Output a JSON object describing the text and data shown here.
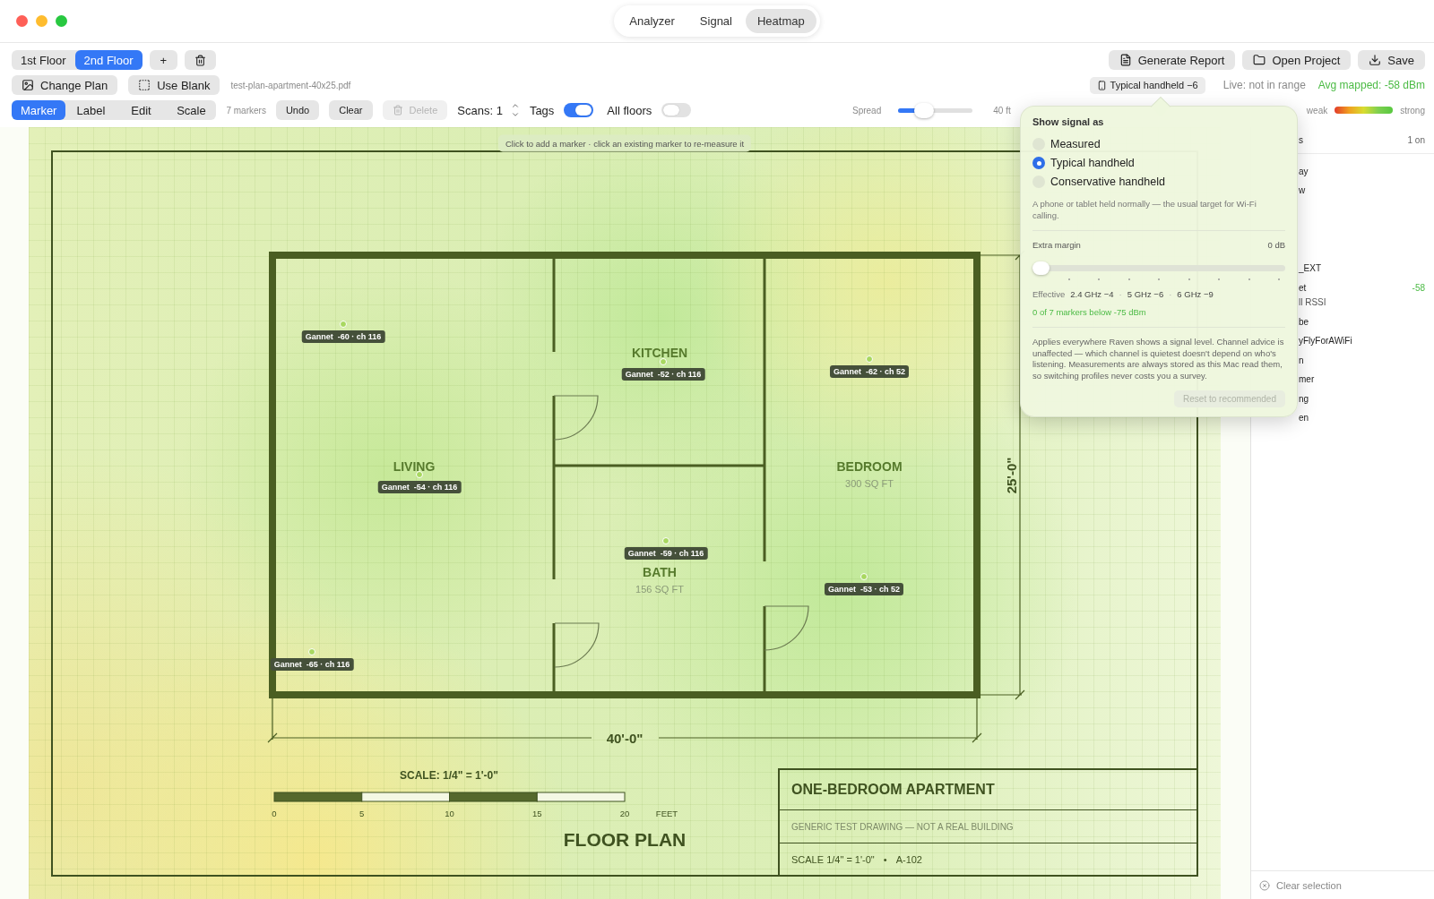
{
  "window": {
    "tabs": [
      {
        "label": "Analyzer",
        "selected": false
      },
      {
        "label": "Signal",
        "selected": false
      },
      {
        "label": "Heatmap",
        "selected": true
      }
    ]
  },
  "floors": {
    "tabs": [
      {
        "label": "1st Floor",
        "selected": false
      },
      {
        "label": "2nd Floor",
        "selected": true
      }
    ],
    "add": "+"
  },
  "plan_buttons": [
    {
      "label": "Change Plan",
      "kind": "image"
    },
    {
      "label": "Use Blank",
      "kind": "blank"
    }
  ],
  "file_name": "test-plan-apartment-40x25.pdf",
  "modes": [
    {
      "label": "Marker",
      "selected": true
    },
    {
      "label": "Label",
      "selected": false
    },
    {
      "label": "Edit",
      "selected": false
    },
    {
      "label": "Scale",
      "selected": false
    }
  ],
  "marker_count": "7 markers",
  "actions": [
    {
      "label": "Undo",
      "disabled": false,
      "kind": "text"
    },
    {
      "label": "Clear",
      "disabled": false,
      "kind": "text"
    },
    {
      "label": "Delete",
      "disabled": true,
      "kind": "trash"
    }
  ],
  "scans": "Scans: 1",
  "toggles": [
    {
      "label": "Tags",
      "on": true
    },
    {
      "label": "All floors",
      "on": false
    }
  ],
  "top_actions": [
    {
      "label": "Generate Report",
      "kind": "report"
    },
    {
      "label": "Open Project",
      "kind": "folder"
    },
    {
      "label": "Save",
      "kind": "save"
    }
  ],
  "profile_button": "Typical handheld −6",
  "live_status": "Live: not in range",
  "avg_mapped": "Avg mapped: -58 dBm",
  "spread": {
    "label": "Spread",
    "level": 0.35,
    "reading": "40 ft"
  },
  "legend": {
    "weak": "weak",
    "strong": "strong"
  },
  "canvas": {
    "hint": "Click to add a marker · click an existing marker to re-measure it",
    "rooms": [
      {
        "name": "KITCHEN"
      },
      {
        "name": "LIVING"
      },
      {
        "name": "BEDROOM",
        "area": "300 SQ FT"
      },
      {
        "name": "BATH",
        "area": "156 SQ FT"
      }
    ],
    "markers": [
      {
        "label": "Gannet  -60 · ch 116"
      },
      {
        "label": "Gannet  -52 · ch 116"
      },
      {
        "label": "Gannet  -62 · ch 52"
      },
      {
        "label": "Gannet  -54 · ch 116"
      },
      {
        "label": "Gannet  -59 · ch 116"
      },
      {
        "label": "Gannet  -53 · ch 52"
      },
      {
        "label": "Gannet  -65 · ch 116"
      }
    ],
    "dimensions": {
      "height": "25'-0\"",
      "width": "40'-0\""
    },
    "scale": {
      "title": "SCALE: 1/4\" = 1'-0\"",
      "ticks": [
        "0",
        "5",
        "10",
        "15",
        "20"
      ],
      "unit": "FEET"
    },
    "plan_title": "FLOOR PLAN",
    "title_block": {
      "project": "ONE-BEDROOM APARTMENT",
      "note": "GENERIC TEST DRAWING — NOT A REAL BUILDING",
      "scale": "SCALE 1/4\" = 1'-0\"",
      "separator": "•",
      "sheet": "A-102"
    }
  },
  "popover": {
    "title": "Show signal as",
    "options": [
      {
        "label": "Measured",
        "selected": false
      },
      {
        "label": "Typical handheld",
        "selected": true
      },
      {
        "label": "Conservative handheld",
        "selected": false
      }
    ],
    "description": "A phone or tablet held normally — the usual target for Wi-Fi calling.",
    "margin": {
      "label": "Extra margin",
      "reading": "0 dB",
      "level": 0
    },
    "effective": {
      "label": "Effective",
      "bands": [
        "2.4 GHz −4",
        "5 GHz −6",
        "6 GHz −9"
      ],
      "separator": "·"
    },
    "summary": "0 of 7 markers below -75 dBm",
    "note": "Applies everywhere Raven shows a signal level. Channel advice is unaffected — which channel is quietest doesn't depend on who's listening. Measurements are always stored as this Mac read them, so switching profiles never costs you a survey.",
    "reset": "Reset to recommended"
  },
  "sidebar": {
    "header": "s",
    "count": "1 on",
    "items": [
      {
        "text": "ay",
        "kind": "name"
      },
      {
        "text": "w",
        "kind": "name"
      },
      {
        "text": "_EXT",
        "kind": "name"
      },
      {
        "text": "et",
        "kind": "name",
        "value": "-58"
      },
      {
        "text": "ll RSSI",
        "kind": "detail"
      },
      {
        "text": "be",
        "kind": "name"
      },
      {
        "text": "yFlyForAWiFi",
        "kind": "name"
      },
      {
        "text": "n",
        "kind": "name"
      },
      {
        "text": "mer",
        "kind": "name"
      },
      {
        "text": "ng",
        "kind": "name"
      },
      {
        "text": "en",
        "kind": "name"
      }
    ],
    "footer": "Clear selection"
  }
}
